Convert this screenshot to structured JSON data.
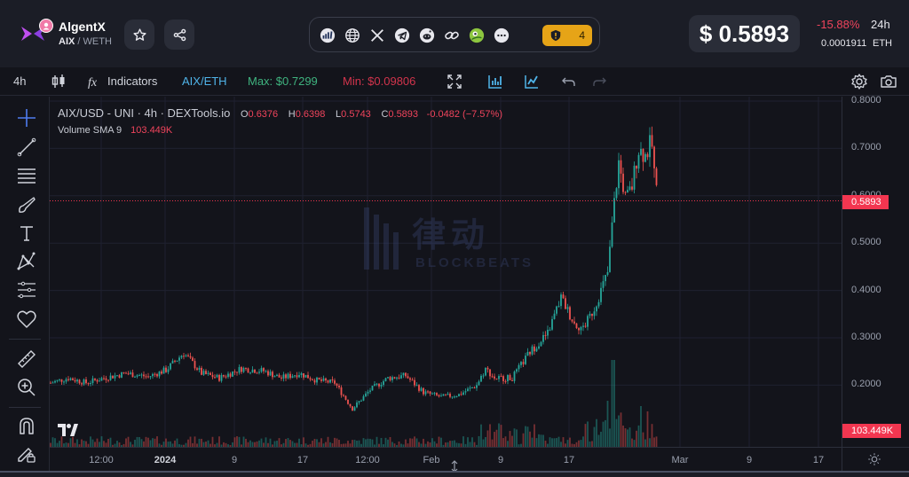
{
  "header": {
    "token_name": "AlgentX",
    "pair_base": "AIX",
    "pair_quote": "WETH",
    "price": "$ 0.5893",
    "change_pct": "-15.88%",
    "change_period": "24h",
    "eth_price": "0.0001911",
    "eth_unit": "ETH",
    "audit_count": "4"
  },
  "toolbar": {
    "interval": "4h",
    "indicators_label": "Indicators",
    "pair": "AIX/ETH",
    "max_label": "Max: $0.7299",
    "min_label": "Min: $0.09806",
    "colors": {
      "pair": "#4fb3e8",
      "max": "#3fb37f",
      "min": "#d2344c"
    }
  },
  "legend": {
    "title": "AIX/USD - UNI · 4h · DEXTools.io",
    "o_key": "O",
    "o_val": "0.6376",
    "h_key": "H",
    "h_val": "0.6398",
    "l_key": "L",
    "l_val": "0.5743",
    "c_key": "C",
    "c_val": "0.5893",
    "change": "-0.0482 (−7.57%)",
    "volume_label": "Volume SMA 9",
    "volume_val": "103.449K"
  },
  "watermark": {
    "cn": "律动",
    "en": "BLOCKBEATS"
  },
  "chart_data": {
    "type": "candlestick",
    "price_axis_ticks": [
      "0.8000",
      "0.7000",
      "0.6000",
      "0.5000",
      "0.4000",
      "0.3000",
      "0.2000"
    ],
    "time_axis_ticks": [
      "12:00",
      "2024",
      "9",
      "17",
      "12:00",
      "Feb",
      "9",
      "17",
      "Mar",
      "9",
      "17"
    ],
    "last_price_tag": "0.5893",
    "volume_tag": "103.449K",
    "colors": {
      "up": "#26a69a",
      "down": "#ef5350",
      "last_price": "#f23650"
    },
    "price_path": [
      [
        0,
        0.205
      ],
      [
        20,
        0.215
      ],
      [
        40,
        0.205
      ],
      [
        60,
        0.215
      ],
      [
        85,
        0.225
      ],
      [
        110,
        0.218
      ],
      [
        130,
        0.232
      ],
      [
        150,
        0.268
      ],
      [
        170,
        0.225
      ],
      [
        190,
        0.215
      ],
      [
        215,
        0.235
      ],
      [
        240,
        0.23
      ],
      [
        260,
        0.215
      ],
      [
        280,
        0.225
      ],
      [
        300,
        0.21
      ],
      [
        320,
        0.205
      ],
      [
        340,
        0.15
      ],
      [
        360,
        0.19
      ],
      [
        380,
        0.215
      ],
      [
        400,
        0.22
      ],
      [
        420,
        0.185
      ],
      [
        440,
        0.175
      ],
      [
        460,
        0.18
      ],
      [
        480,
        0.2
      ],
      [
        490,
        0.235
      ],
      [
        500,
        0.215
      ],
      [
        520,
        0.215
      ],
      [
        540,
        0.27
      ],
      [
        560,
        0.31
      ],
      [
        575,
        0.385
      ],
      [
        590,
        0.33
      ],
      [
        600,
        0.32
      ],
      [
        612,
        0.36
      ],
      [
        620,
        0.4
      ],
      [
        628,
        0.44
      ],
      [
        633,
        0.55
      ],
      [
        640,
        0.67
      ],
      [
        648,
        0.59
      ],
      [
        655,
        0.62
      ],
      [
        662,
        0.7
      ],
      [
        670,
        0.685
      ],
      [
        677,
        0.715
      ],
      [
        681,
        0.63
      ],
      [
        684,
        0.5893
      ]
    ]
  }
}
